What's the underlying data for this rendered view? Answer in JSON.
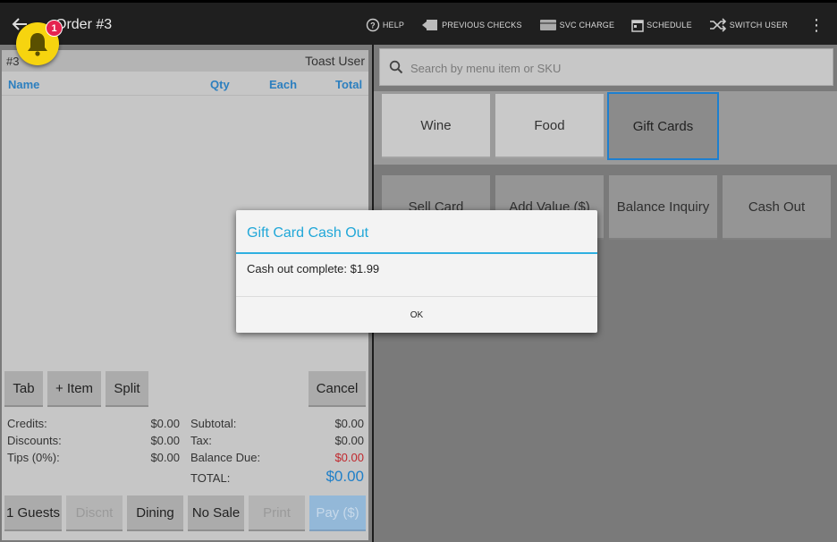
{
  "header": {
    "title": "Order #3",
    "actions": [
      {
        "label": "HELP",
        "icon": "help-icon"
      },
      {
        "label": "PREVIOUS CHECKS",
        "icon": "previous-checks-icon"
      },
      {
        "label": "SVC CHARGE",
        "icon": "credit-card-icon"
      },
      {
        "label": "SCHEDULE",
        "icon": "calendar-icon"
      },
      {
        "label": "SWITCH USER",
        "icon": "shuffle-icon"
      }
    ],
    "overflow": "⋮"
  },
  "notifications": {
    "count": "1",
    "color": "#f6d40f",
    "badge_color": "#e5234f"
  },
  "order": {
    "number": "#3",
    "user": "Toast User",
    "columns": {
      "name": "Name",
      "qty": "Qty",
      "each": "Each",
      "total": "Total"
    },
    "buttons": {
      "tab": "Tab",
      "add_item": "+ Item",
      "split": "Split",
      "cancel": "Cancel"
    },
    "totals": {
      "credits_label": "Credits:",
      "credits": "$0.00",
      "discounts_label": "Discounts:",
      "discounts": "$0.00",
      "tips_label": "Tips (0%):",
      "tips": "$0.00",
      "subtotal_label": "Subtotal:",
      "subtotal": "$0.00",
      "tax_label": "Tax:",
      "tax": "$0.00",
      "balance_label": "Balance Due:",
      "balance": "$0.00",
      "total_label": "TOTAL:",
      "total": "$0.00"
    },
    "bottom_buttons": {
      "guests": "1 Guests",
      "discount": "Discnt",
      "dining": "Dining",
      "no_sale": "No Sale",
      "print": "Print",
      "pay": "Pay ($)"
    }
  },
  "menu": {
    "search_placeholder": "Search by menu item or SKU",
    "categories": [
      "Wine",
      "Food",
      "Gift Cards"
    ],
    "selected_category": "Gift Cards",
    "gift_card_actions": [
      "Sell Card",
      "Add Value ($)",
      "Balance Inquiry",
      "Cash Out"
    ]
  },
  "dialog": {
    "title": "Gift Card Cash Out",
    "message": "Cash out complete: $1.99",
    "ok": "OK"
  },
  "colors": {
    "accent": "#20a7d8",
    "selection": "#1d7fcf",
    "column_header": "#2c7fbf",
    "balance_due": "#c0272d",
    "total": "#1f7fc8"
  }
}
